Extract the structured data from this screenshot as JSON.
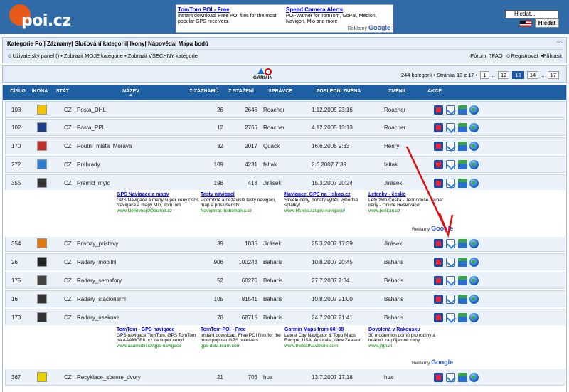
{
  "header": {
    "logo_text": "poi.cz",
    "search_placeholder": "Hledat...",
    "search_button": "Hledat",
    "ad": {
      "col1_title": "TomTom POI - Free",
      "col1_text": "Instant download. Free POI files for the most popular GPS receivers.",
      "col2_title": "Speed Camera Alerts",
      "col2_text": "POI-Warner for TomTom, GoPal, Medion, Navigon, Mio and more",
      "google_label": "Reklamy",
      "google_word": "Google"
    }
  },
  "nav": {
    "menu": [
      "Kategorie Poi",
      "Záznamy",
      "Slučování kategorií",
      "Ikony",
      "Nápověda",
      "Mapa bodů"
    ],
    "collapse": "^^",
    "user_panel": "Uživatelský panel ()",
    "sub_links": [
      "Zobrazit MOJE kategorie",
      "Zobrazit VŠECHNY kategorie"
    ],
    "right_links": [
      "Fórum",
      "FAQ",
      "Registrovat",
      "Přihlásit"
    ]
  },
  "toolbar": {
    "garmin_label": "GARMIN",
    "pager_text": "244 kategorií • Stránka 13 z 17 •",
    "pages": [
      "1",
      "...",
      "12",
      "13",
      "14",
      "...",
      "17"
    ],
    "current_page": "13"
  },
  "table": {
    "headers": [
      "ČÍSLO",
      "IKONA",
      "STÁT",
      "NÁZEV",
      "Σ ZÁZNAMŮ",
      "Σ STAŽENÍ",
      "SPRÁVCE",
      "POSLEDNÍ ZMĚNA",
      "ZMĚNIL",
      "AKCE"
    ],
    "name_sort": "▲",
    "rows": [
      {
        "num": "103",
        "icon": "dhl-icon",
        "country": "CZ",
        "name": "Posta_DHL",
        "records": "26",
        "downloads": "2646",
        "admin": "Roacher",
        "changed": "1.12.2005 23:16",
        "changed_by": "Roacher"
      },
      {
        "num": "102",
        "icon": "ppl-icon",
        "country": "CZ",
        "name": "Posta_PPL",
        "records": "12",
        "downloads": "2765",
        "admin": "Roacher",
        "changed": "4.12.2005 13:13",
        "changed_by": "Roacher"
      },
      {
        "num": "170",
        "icon": "ladybug-icon",
        "country": "CZ",
        "name": "Poutni_mista_Morava",
        "records": "32",
        "downloads": "2017",
        "admin": "Quack",
        "changed": "16.6.2006 9:33",
        "changed_by": "Henry"
      },
      {
        "num": "272",
        "icon": "waves-icon",
        "country": "CZ",
        "name": "Prehrady",
        "records": "109",
        "downloads": "4231",
        "admin": "faltak",
        "changed": "2.6.2007 7:39",
        "changed_by": "faltak"
      },
      {
        "num": "355",
        "icon": "toll-icon",
        "country": "CZ",
        "name": "Premid_myto",
        "records": "196",
        "downloads": "418",
        "admin": "Jirásek",
        "changed": "15.3.2007 20:24",
        "changed_by": "Jirásek"
      },
      {
        "num": "354",
        "icon": "port-icon",
        "country": "CZ",
        "name": "Privozy_pristavy",
        "records": "39",
        "downloads": "1035",
        "admin": "Jirásek",
        "changed": "25.3.2007 17:39",
        "changed_by": "Jirásek"
      },
      {
        "num": "26",
        "icon": "radar-mobile-icon",
        "country": "CZ",
        "name": "Radary_mobilni",
        "records": "906",
        "downloads": "100243",
        "admin": "Baharis",
        "changed": "10.8.2007 20:45",
        "changed_by": "Baharis"
      },
      {
        "num": "175",
        "icon": "traffic-light-icon",
        "country": "CZ",
        "name": "Radary_semafory",
        "records": "52",
        "downloads": "60270",
        "admin": "Baharis",
        "changed": "27.7.2007 7:34",
        "changed_by": "Baharis"
      },
      {
        "num": "16",
        "icon": "radar-fixed-icon",
        "country": "CZ",
        "name": "Radary_stacionarni",
        "records": "105",
        "downloads": "81541",
        "admin": "Baharis",
        "changed": "10.8.2007 21:00",
        "changed_by": "Baharis"
      },
      {
        "num": "173",
        "icon": "radar-section-icon",
        "country": "CZ",
        "name": "Radary_usekove",
        "records": "76",
        "downloads": "68715",
        "admin": "Baharis",
        "changed": "24.7.2007 21:41",
        "changed_by": "Baharis"
      },
      {
        "num": "367",
        "icon": "recycle-icon",
        "country": "CZ",
        "name": "Recyklace_sberne_dvory",
        "records": "21",
        "downloads": "706",
        "admin": "hpa",
        "changed": "13.7.2007 17:18",
        "changed_by": "hpa"
      }
    ]
  },
  "ads1": [
    {
      "title": "GPS Navigace a mapy",
      "text": "GPS Navigace a mapy super ceny GPS Navigace a mapy Mio, TomTom",
      "url": "www.NejlevnejsiObchod.cz"
    },
    {
      "title": "Testy navigací",
      "text": "Podrobné a nezávislé testy navigací, map a příslušenství",
      "url": "Navigovat.mobilmania.cz"
    },
    {
      "title": "Navigace, GPS na Hshop.cz",
      "text": "Skvělé ceny, bohatý výběr, výhodné splátky!",
      "url": "www.Hshop.cz/gps-navigace/"
    },
    {
      "title": "Letenky - česko",
      "text": "Lety z/do Česka - Jednoduše. Super ceny - Online Reservace!",
      "url": "www.pelikan.cz"
    }
  ],
  "ads2": [
    {
      "title": "TomTom - GPS navigace",
      "text": "GPS navigace TomTom, GPS TomTom na AAAMOBIL.cz za super ceny!",
      "url": "www.aaamobil.cz/gps-navigace"
    },
    {
      "title": "TomTom POI - Free",
      "text": "Instant download. Free POI files for the most popular GPS receivers.",
      "url": "gps-data-team.com"
    },
    {
      "title": "Garmin Maps from 60/ 88",
      "text": "Latest City Navigator & Topo Maps Europe, USA, Australia, New Zealand",
      "url": "www.theSatNavStore.com"
    },
    {
      "title": "Dovolená v Rakousku",
      "text": "30 moderních domů pro rodiny a mládež za příjemné ceny.",
      "url": "www.jfgh.at"
    }
  ],
  "ad_google": {
    "label": "Reklamy",
    "word": "Google"
  },
  "colors": {
    "header_bg": "#316ba7",
    "table_header_bg": "#1f5fa3",
    "row_bg": "#eaf1f8",
    "arrow": "#e01010"
  }
}
